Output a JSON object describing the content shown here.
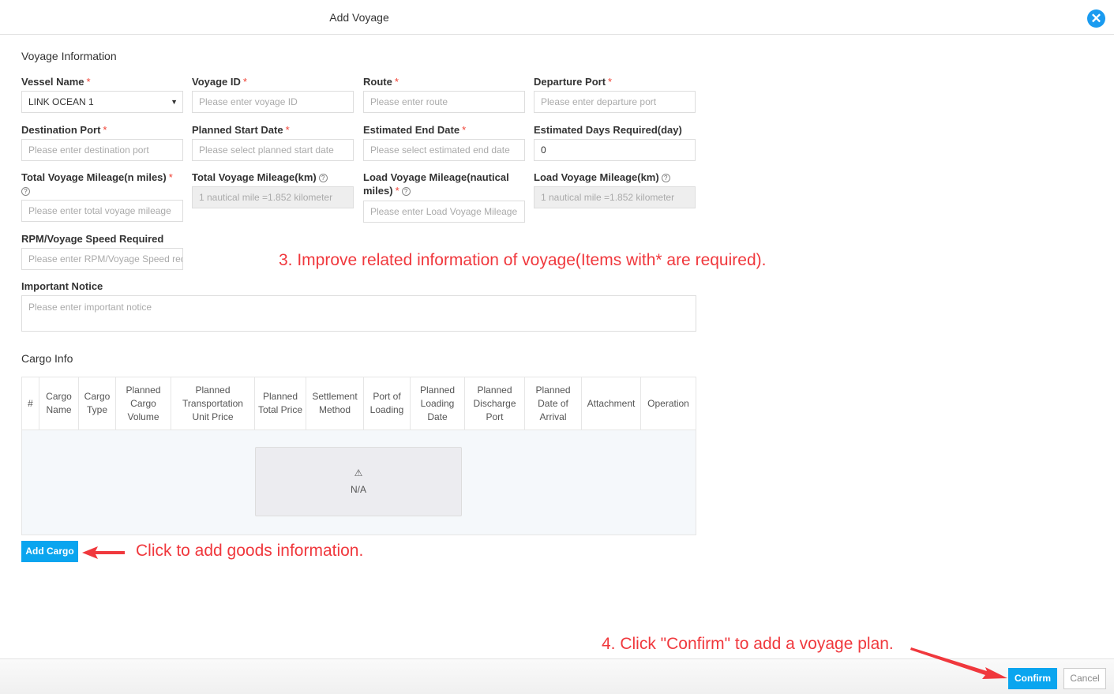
{
  "dialog": {
    "title": "Add Voyage",
    "close_icon": "close-icon"
  },
  "voyage_section": "Voyage Information",
  "fields": {
    "vessel_name": {
      "label": "Vessel Name",
      "value": "LINK OCEAN 1"
    },
    "voyage_id": {
      "label": "Voyage ID",
      "placeholder": "Please enter voyage ID"
    },
    "route": {
      "label": "Route",
      "placeholder": "Please enter route"
    },
    "departure_port": {
      "label": "Departure Port",
      "placeholder": "Please enter departure port"
    },
    "destination_port": {
      "label": "Destination Port",
      "placeholder": "Please enter destination port"
    },
    "planned_start_date": {
      "label": "Planned Start Date",
      "placeholder": "Please select planned start date"
    },
    "estimated_end_date": {
      "label": "Estimated End Date",
      "placeholder": "Please select estimated end date"
    },
    "estimated_days": {
      "label": "Estimated Days Required(day)",
      "value": "0"
    },
    "total_mileage_nm": {
      "label": "Total Voyage Mileage(n miles)",
      "placeholder": "Please enter total voyage mileage"
    },
    "total_mileage_km": {
      "label": "Total Voyage Mileage(km)",
      "placeholder": "1 nautical mile =1.852 kilometer"
    },
    "load_mileage_nm": {
      "label": "Load Voyage Mileage(nautical miles)",
      "placeholder": "Please enter Load Voyage Mileage"
    },
    "load_mileage_km": {
      "label": "Load Voyage Mileage(km)",
      "placeholder": "1 nautical mile =1.852 kilometer"
    },
    "rpm_speed": {
      "label": "RPM/Voyage Speed Required",
      "placeholder": "Please enter RPM/Voyage Speed required"
    },
    "important_notice": {
      "label": "Important Notice",
      "placeholder": "Please enter important notice"
    }
  },
  "required_mark": "*",
  "help_mark": "?",
  "cargo_section": "Cargo Info",
  "cargo_table": {
    "columns": [
      "#",
      "Cargo Name",
      "Cargo Type",
      "Planned Cargo Volume",
      "Planned Transportation Unit Price",
      "Planned Total Price",
      "Settlement Method",
      "Port of Loading",
      "Planned Loading Date",
      "Planned Discharge Port",
      "Planned Date of Arrival",
      "Attachment",
      "Operation"
    ],
    "empty_icon": "warning-icon",
    "empty_glyph": "⚠",
    "empty_text": "N/A"
  },
  "add_cargo_label": "Add Cargo",
  "annotations": {
    "step3": "3. Improve related information of voyage(Items with* are required).",
    "add_cargo": "Click to add goods information.",
    "step4": "4. Click \"Confirm\" to add a voyage plan."
  },
  "footer": {
    "confirm_label": "Confirm",
    "cancel_label": "Cancel"
  },
  "colors": {
    "primary": "#0aa5ef",
    "annotation": "#f0383d",
    "required": "#f04134"
  }
}
